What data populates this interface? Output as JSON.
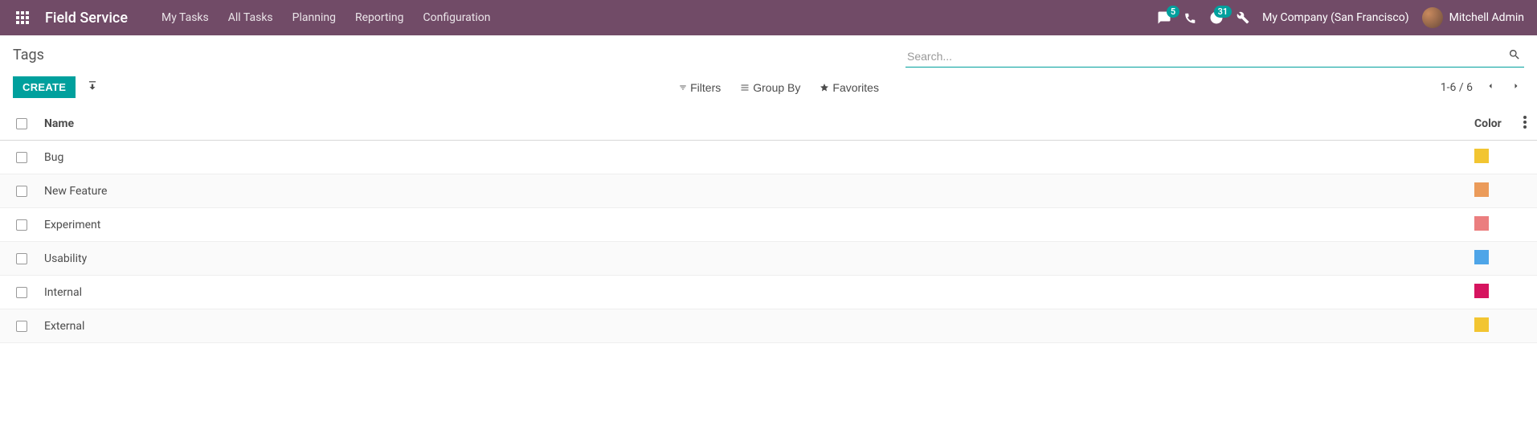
{
  "header": {
    "brand": "Field Service",
    "menu": [
      "My Tasks",
      "All Tasks",
      "Planning",
      "Reporting",
      "Configuration"
    ],
    "messaging_badge": "5",
    "activities_badge": "31",
    "company": "My Company (San Francisco)",
    "user": "Mitchell Admin"
  },
  "breadcrumb": "Tags",
  "search": {
    "placeholder": "Search..."
  },
  "buttons": {
    "create": "CREATE"
  },
  "toolbar": {
    "filters": "Filters",
    "groupby": "Group By",
    "favorites": "Favorites"
  },
  "pager": {
    "text": "1-6 / 6"
  },
  "columns": {
    "name": "Name",
    "color": "Color"
  },
  "rows": [
    {
      "name": "Bug",
      "color": "#f2c531"
    },
    {
      "name": "New Feature",
      "color": "#eb9b5a"
    },
    {
      "name": "Experiment",
      "color": "#eb7e7f"
    },
    {
      "name": "Usability",
      "color": "#4ea5e8"
    },
    {
      "name": "Internal",
      "color": "#d6145f"
    },
    {
      "name": "External",
      "color": "#f2c531"
    }
  ]
}
